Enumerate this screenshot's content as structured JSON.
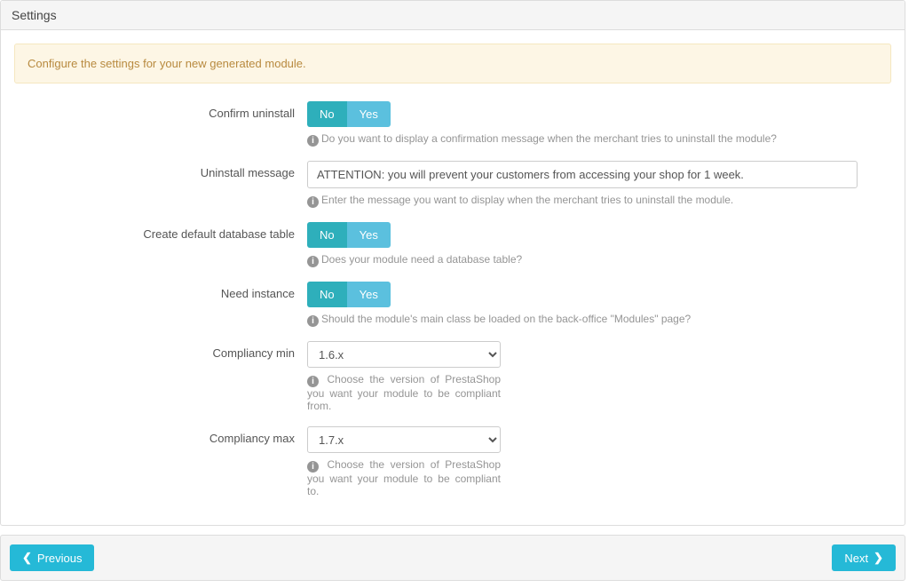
{
  "panel": {
    "title": "Settings",
    "alert": "Configure the settings for your new generated module."
  },
  "toggle_labels": {
    "no": "No",
    "yes": "Yes"
  },
  "fields": {
    "confirm_uninstall": {
      "label": "Confirm uninstall",
      "value": "Yes",
      "help": "Do you want to display a confirmation message when the merchant tries to uninstall the module?"
    },
    "uninstall_message": {
      "label": "Uninstall message",
      "value": "ATTENTION: you will prevent your customers from accessing your shop for 1 week.",
      "help": "Enter the message you want to display when the merchant tries to uninstall the module."
    },
    "create_db": {
      "label": "Create default database table",
      "value": "Yes",
      "help": "Does your module need a database table?"
    },
    "need_instance": {
      "label": "Need instance",
      "value": "Yes",
      "help": "Should the module's main class be loaded on the back-office \"Modules\" page?"
    },
    "compliancy_min": {
      "label": "Compliancy min",
      "value": "1.6.x",
      "options": [
        "1.6.x"
      ],
      "help": "Choose the version of PrestaShop you want your module to be compliant from."
    },
    "compliancy_max": {
      "label": "Compliancy max",
      "value": "1.7.x",
      "options": [
        "1.7.x"
      ],
      "help": "Choose the version of PrestaShop you want your module to be compliant to."
    }
  },
  "footer": {
    "previous": "Previous",
    "next": "Next"
  }
}
